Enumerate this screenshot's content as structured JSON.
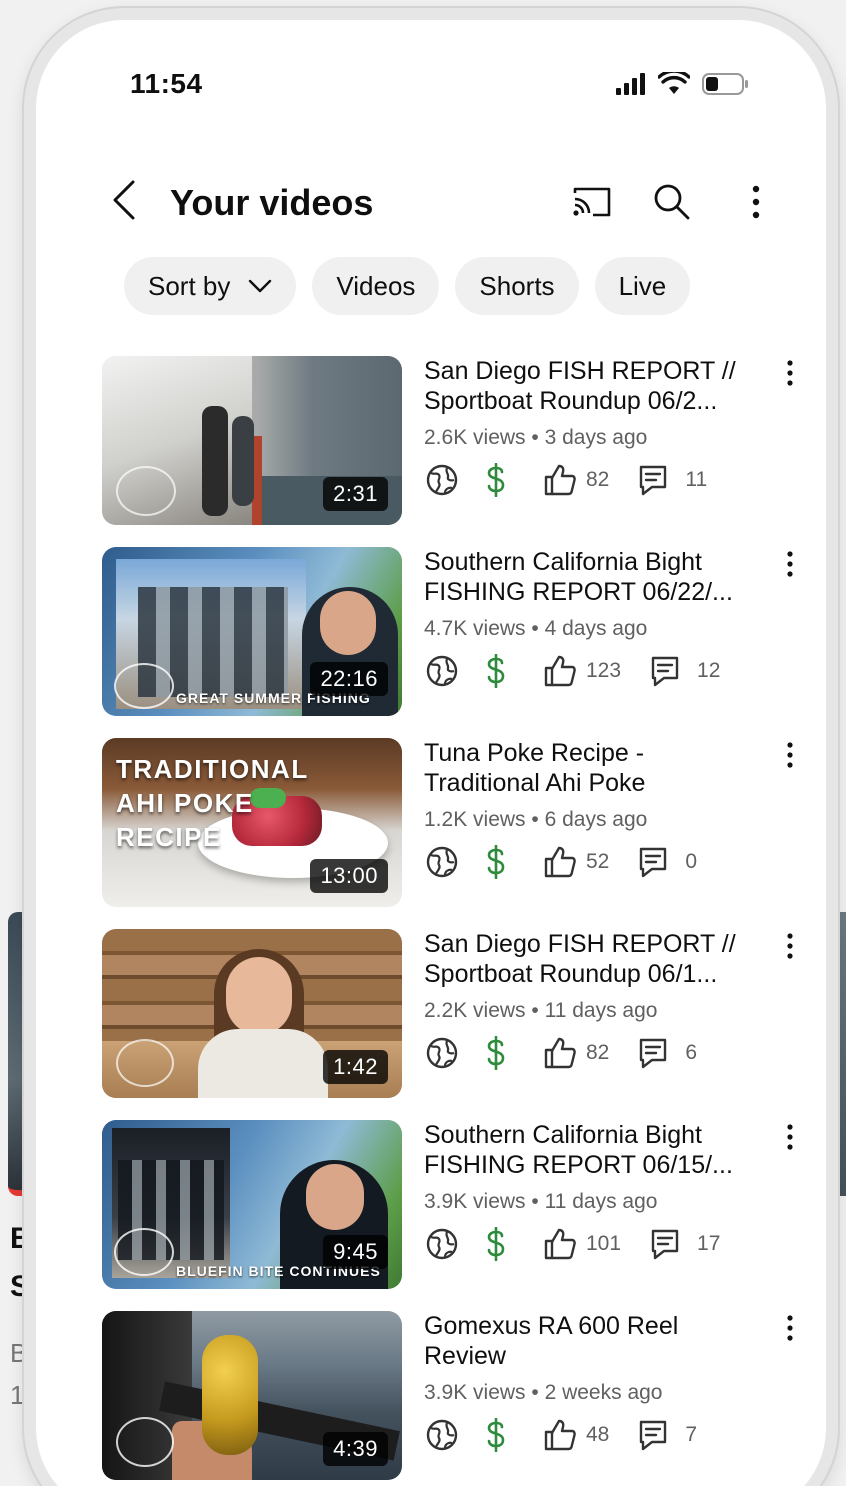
{
  "status": {
    "time": "11:54"
  },
  "header": {
    "title": "Your videos"
  },
  "chips": [
    {
      "label": "Sort by"
    },
    {
      "label": "Videos"
    },
    {
      "label": "Shorts"
    },
    {
      "label": "Live"
    }
  ],
  "videos": [
    {
      "title": "San Diego FISH REPORT // Sportboat Roundup 06/2...",
      "views": "2.6K views",
      "age": "3 days ago",
      "duration": "2:31",
      "likes": "82",
      "comments": "11"
    },
    {
      "title": "Southern California Bight FISHING REPORT 06/22/...",
      "views": "4.7K views",
      "age": "4 days ago",
      "duration": "22:16",
      "likes": "123",
      "comments": "12",
      "caption": "GREAT SUMMER FISHING"
    },
    {
      "title": "Tuna Poke Recipe - Traditional Ahi Poke",
      "views": "1.2K views",
      "age": "6 days ago",
      "duration": "13:00",
      "likes": "52",
      "comments": "0",
      "overlay": "TRADITIONAL AHI POKE RECIPE"
    },
    {
      "title": "San Diego FISH REPORT // Sportboat Roundup 06/1...",
      "views": "2.2K views",
      "age": "11 days ago",
      "duration": "1:42",
      "likes": "82",
      "comments": "6"
    },
    {
      "title": "Southern California Bight FISHING REPORT 06/15/...",
      "views": "3.9K views",
      "age": "11 days ago",
      "duration": "9:45",
      "likes": "101",
      "comments": "17",
      "caption": "BLUEFIN BITE CONTINUES"
    },
    {
      "title": "Gomexus RA 600 Reel Review",
      "views": "3.9K views",
      "age": "2 weeks ago",
      "duration": "4:39",
      "likes": "48",
      "comments": "7"
    }
  ],
  "icons": {
    "visibility": "globe-icon",
    "monetization": "dollar-icon",
    "likes": "thumbs-up-icon",
    "comments": "comment-icon"
  },
  "colors": {
    "monetized": "#2e8b3c",
    "chip_bg": "#f0f0f0",
    "meta_text": "#606060"
  }
}
